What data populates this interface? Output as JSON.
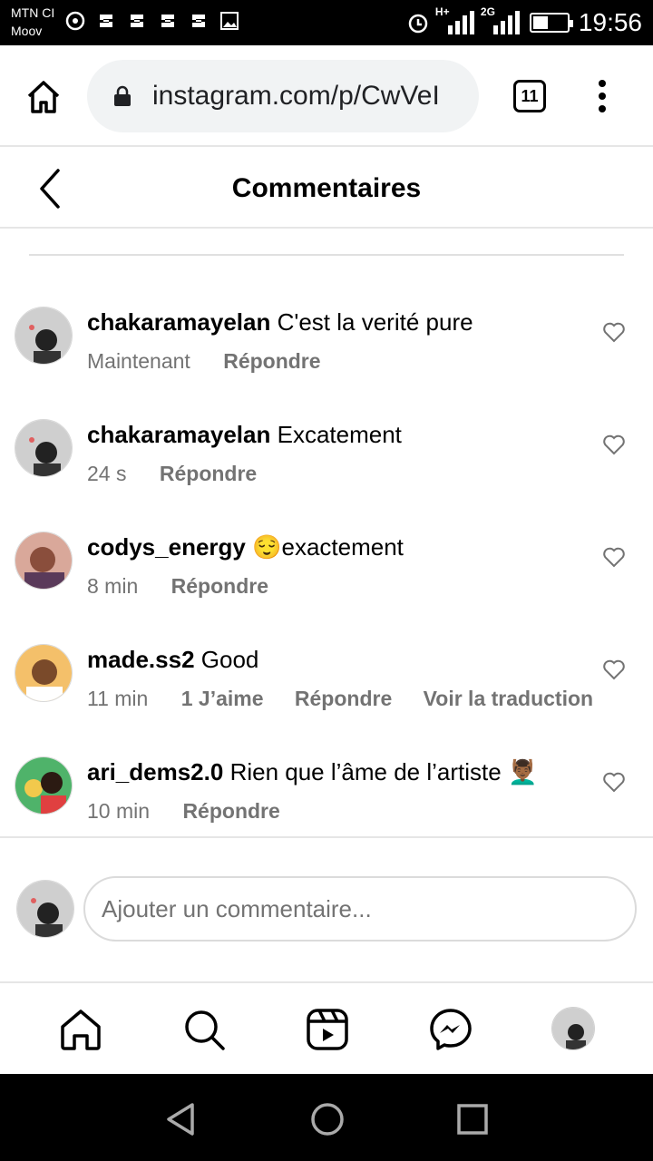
{
  "status_bar": {
    "carrier1": "MTN CI",
    "carrier2": "Moov",
    "net1": "H+",
    "net2": "2G",
    "battery_level": 0.45,
    "time": "19:56"
  },
  "browser": {
    "url": "instagram.com/p/CwVeI",
    "tab_count": "11"
  },
  "header": {
    "title": "Commentaires"
  },
  "comments": [
    {
      "username": "chakaramayelan",
      "text": "C'est la verité pure",
      "time": "Maintenant",
      "likes": "",
      "reply_label": "Répondre",
      "translate_label": ""
    },
    {
      "username": "chakaramayelan",
      "text": "Excatement",
      "time": "24 s",
      "likes": "",
      "reply_label": "Répondre",
      "translate_label": ""
    },
    {
      "username": "codys_energy",
      "text": "😌exactement",
      "time": "8 min",
      "likes": "",
      "reply_label": "Répondre",
      "translate_label": ""
    },
    {
      "username": "made.ss2",
      "text": "Good",
      "time": "11 min",
      "likes": "1 J’aime",
      "reply_label": "Répondre",
      "translate_label": "Voir la traduction"
    },
    {
      "username": "ari_dems2.0",
      "text": "Rien que l’âme de l’artiste 💆🏾‍♂️",
      "time": "10 min",
      "likes": "",
      "reply_label": "Répondre",
      "translate_label": ""
    }
  ],
  "comment_input": {
    "placeholder": "Ajouter un commentaire..."
  },
  "bottom_nav": {
    "items": [
      "home-icon",
      "search-icon",
      "reels-icon",
      "messenger-icon",
      "profile-avatar"
    ]
  },
  "colors": {
    "secondary_text": "#737373",
    "divider": "#e6e6e6"
  }
}
